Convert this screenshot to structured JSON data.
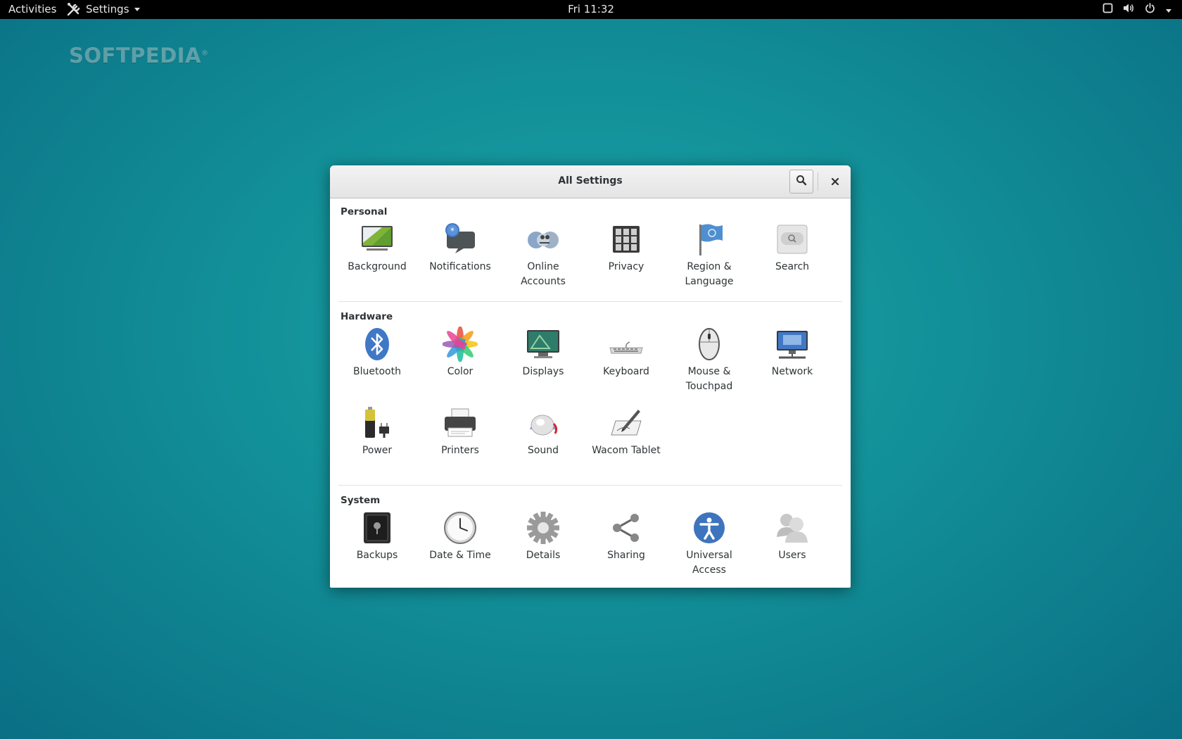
{
  "topbar": {
    "activities": "Activities",
    "app_menu": "Settings",
    "clock": "Fri 11:32"
  },
  "watermark": "SOFTPEDIA",
  "window": {
    "title": "All Settings"
  },
  "sections": [
    {
      "heading": "Personal",
      "items": [
        {
          "label": "Background",
          "icon": "background-icon"
        },
        {
          "label": "Notifications",
          "icon": "notifications-icon"
        },
        {
          "label": "Online\nAccounts",
          "icon": "online-accounts-icon"
        },
        {
          "label": "Privacy",
          "icon": "privacy-icon"
        },
        {
          "label": "Region &\nLanguage",
          "icon": "region-language-icon"
        },
        {
          "label": "Search",
          "icon": "search-icon"
        }
      ]
    },
    {
      "heading": "Hardware",
      "items": [
        {
          "label": "Bluetooth",
          "icon": "bluetooth-icon"
        },
        {
          "label": "Color",
          "icon": "color-icon"
        },
        {
          "label": "Displays",
          "icon": "displays-icon"
        },
        {
          "label": "Keyboard",
          "icon": "keyboard-icon"
        },
        {
          "label": "Mouse &\nTouchpad",
          "icon": "mouse-icon"
        },
        {
          "label": "Network",
          "icon": "network-icon"
        },
        {
          "label": "Power",
          "icon": "power-icon"
        },
        {
          "label": "Printers",
          "icon": "printers-icon"
        },
        {
          "label": "Sound",
          "icon": "sound-icon"
        },
        {
          "label": "Wacom Tablet",
          "icon": "wacom-tablet-icon"
        }
      ]
    },
    {
      "heading": "System",
      "items": [
        {
          "label": "Backups",
          "icon": "backups-icon"
        },
        {
          "label": "Date & Time",
          "icon": "date-time-icon"
        },
        {
          "label": "Details",
          "icon": "details-icon"
        },
        {
          "label": "Sharing",
          "icon": "sharing-icon"
        },
        {
          "label": "Universal\nAccess",
          "icon": "universal-access-icon"
        },
        {
          "label": "Users",
          "icon": "users-icon"
        }
      ]
    }
  ]
}
